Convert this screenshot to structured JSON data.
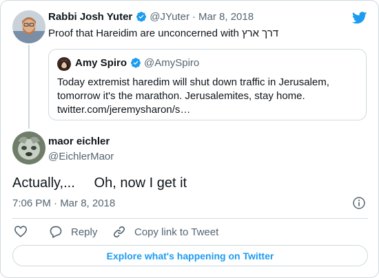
{
  "parent_tweet": {
    "author_name": "Rabbi Josh Yuter",
    "author_handle": "@JYuter",
    "separator": "·",
    "date": "Mar 8, 2018",
    "text": "Proof that Hareidim are unconcerned with דרך ארץ"
  },
  "quoted_tweet": {
    "author_name": "Amy Spiro",
    "author_handle": "@AmySpiro",
    "lines": [
      "Today extremist haredim will shut down traffic in Jerusalem,",
      "tomorrow it's the marathon. Jerusalemites, stay home.",
      "twitter.com/jeremysharon/s…"
    ]
  },
  "main_tweet": {
    "author_name": "maor eichler",
    "author_handle": "@EichlerMaor",
    "text": "Actually,...     Oh, now I get it",
    "timestamp": "7:06 PM · Mar 8, 2018"
  },
  "actions": {
    "reply_label": "Reply",
    "copy_link_label": "Copy link to Tweet"
  },
  "explore_button_label": "Explore what's happening on Twitter",
  "colors": {
    "accent": "#1d9bf0",
    "text_primary": "#0f1419",
    "text_secondary": "#536471",
    "border": "#cfd9de"
  },
  "icons": [
    "twitter-bird-icon",
    "verified-badge-icon",
    "info-icon",
    "heart-icon",
    "reply-icon",
    "link-icon"
  ]
}
